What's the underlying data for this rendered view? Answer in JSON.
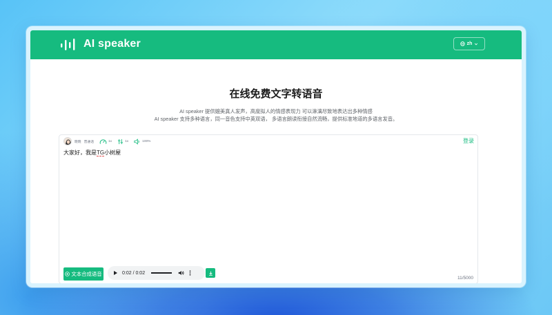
{
  "app": {
    "brand": "AI speaker",
    "accent_color": "#16bb7f"
  },
  "header": {
    "language_label": "zh",
    "language_icon": "globe-icon",
    "chevron_icon": "chevron-down-icon"
  },
  "hero": {
    "title": "在线免费文字转语音",
    "line1": "AI speaker 提供媲美真人发声，高度拟人的情感表现力 可以淋漓尽致地表达出多种情感",
    "line2": "AI speaker 支持多种语言，同一音色支持中英双语， 多语言朗读衔接自然流畅，提供标准地道的多语言发音。"
  },
  "toolbar": {
    "voice_name": "晓晓",
    "voice_style": "普通话",
    "speed_value": "1x",
    "pitch_value": "1x",
    "volume_value": "100%"
  },
  "editor": {
    "login_label": "登录",
    "text_before": "大家好，我是",
    "text_mark": "TG",
    "text_after": "小树屋",
    "char_count": "11/5000"
  },
  "actions": {
    "synthesize_label": "文本合成语音",
    "audio_time": "0:02 / 0:02",
    "audio_progress_fraction": 1.0
  }
}
